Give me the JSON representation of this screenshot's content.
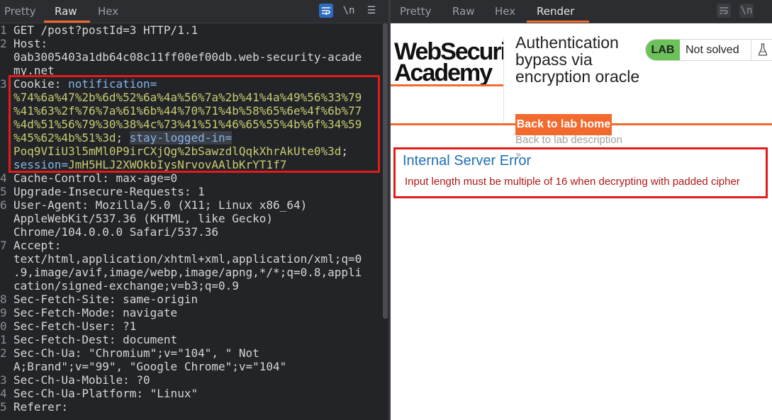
{
  "left": {
    "tabs": [
      {
        "label": "Pretty"
      },
      {
        "label": "Raw"
      },
      {
        "label": "Hex"
      }
    ],
    "icons": [
      "wrap-icon",
      "newline-icon",
      "menu-icon"
    ],
    "newline_label": "\\n",
    "active_tab": "Raw",
    "request": {
      "line1": "GET /post?postId=3 HTTP/1.1",
      "host_name": "Host:",
      "host_value_1": "0ab3005403a1db64c08c11ff00ef00db.web-security-acade",
      "host_value_2": "my.net",
      "cookie_name": "Cookie:",
      "cookie_key_1": "notification",
      "cookie_val_1a": "%74%6a%47%2b%6d%52%6a%4a%56%7a%2b%41%4a%49%56%33%79",
      "cookie_val_1b": "%41%63%2f%76%7a%61%6b%44%70%71%4b%58%65%6e%4f%6b%77",
      "cookie_val_1c": "%4d%51%56%79%30%38%4c%73%41%51%46%65%55%4b%6f%34%59",
      "cookie_val_1d": "%45%62%4b%51%3d",
      "cookie_sep_1": ";",
      "cookie_key_2": "stay-logged-in",
      "cookie_val_2": "Poq9VIiU3l5mMl0P9irCXjQg%2bSawzdlQqkXhrAkUte0%3d",
      "cookie_sep_2": ";",
      "cookie_key_3": "session",
      "cookie_val_3": "JmH5HLJ2XWOkbIysNrvovAAlbKrYT1f7",
      "cache_control": "Cache-Control: max-age=0",
      "upgrade": "Upgrade-Insecure-Requests: 1",
      "ua_1": "User-Agent: Mozilla/5.0 (X11; Linux x86_64)",
      "ua_2": "AppleWebKit/537.36 (KHTML, like Gecko)",
      "ua_3": "Chrome/104.0.0.0 Safari/537.36",
      "accept_1": "Accept:",
      "accept_2": "text/html,application/xhtml+xml,application/xml;q=0",
      "accept_3": ".9,image/avif,image/webp,image/apng,*/*;q=0.8,appli",
      "accept_4": "cation/signed-exchange;v=b3;q=0.9",
      "sfs": "Sec-Fetch-Site: same-origin",
      "sfm": "Sec-Fetch-Mode: navigate",
      "sfu": "Sec-Fetch-User: ?1",
      "sfd": "Sec-Fetch-Dest: document",
      "sch_1": "Sec-Ch-Ua: \"Chromium\";v=\"104\", \" Not",
      "sch_2": "A;Brand\";v=\"99\", \"Google Chrome\";v=\"104\"",
      "schm": "Sec-Ch-Ua-Mobile: ?0",
      "schp": "Sec-Ch-Ua-Platform: \"Linux\"",
      "referer": "Referer:"
    },
    "line_numbers": [
      "1",
      "2",
      "",
      "3",
      "",
      "",
      "",
      "",
      "",
      "4",
      "5",
      "6",
      "",
      "",
      "7",
      "",
      "",
      "",
      "8",
      "9",
      "0",
      "1",
      "2",
      "",
      "3",
      "4",
      "5"
    ]
  },
  "right": {
    "tabs": [
      {
        "label": "Pretty"
      },
      {
        "label": "Raw"
      },
      {
        "label": "Hex"
      },
      {
        "label": "Render"
      }
    ],
    "active_tab": "Render",
    "icons": [
      "wrap-icon",
      "newline-icon"
    ],
    "newline_label": "\\n",
    "page": {
      "logo_line1": "WebSecurity",
      "logo_line2": "Academy",
      "lab_title": "Authentication bypass via encryption oracle",
      "lab_badge": "LAB",
      "lab_status": "Not solved",
      "back_home": "Back to lab home",
      "back_description": "Back to lab description",
      "chevron": "»",
      "error_title": "Internal Server Error",
      "error_message": "Input length must be multiple of 16 when decrypting with padded cipher"
    }
  },
  "colors": {
    "accent_orange": "#f26a2e",
    "highlight_red": "#e31b1b",
    "lab_green": "#6ac259",
    "error_red": "#b11616",
    "link_blue": "#1f6fb3",
    "cookie_key_blue": "#86b4e8",
    "cookie_value_yellow": "#c7cc70"
  }
}
